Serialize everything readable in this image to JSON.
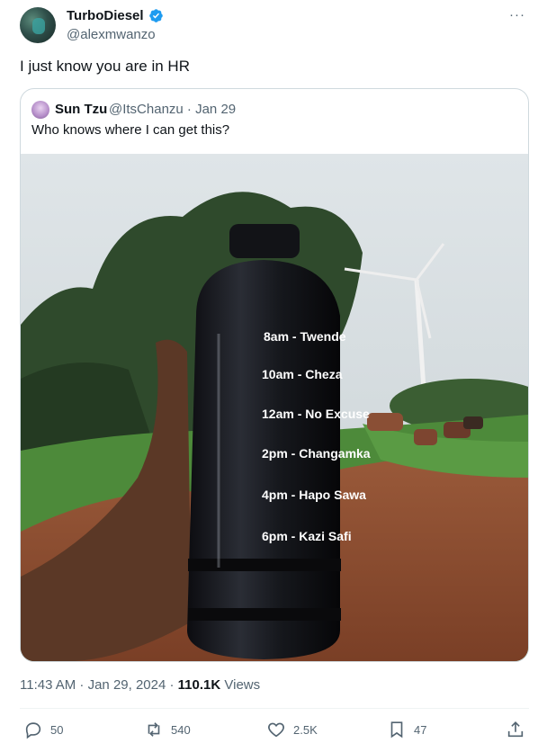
{
  "author": {
    "display_name": "TurboDiesel",
    "handle": "@alexmwanzo",
    "avatar_icon": "profile-photo-icon",
    "verified_icon": "verified-badge-icon",
    "verified_color": "#1d9bf0"
  },
  "more_label": "···",
  "tweet": {
    "text": "I just know you are in HR",
    "timestamp": "11:43 AM · Jan 29, 2024 · ",
    "views_count": "110.1K",
    "views_label": " Views"
  },
  "quoted": {
    "name": "Sun Tzu",
    "meta": "@ItsChanzu · Jan 29",
    "text": "Who knows where I can get this?",
    "bottle_schedule": [
      "8am - Twende",
      "10am - Cheza",
      "12am - No Excuse",
      "2pm - Changamka",
      "4pm - Hapo Sawa",
      "6pm - Kazi Safi"
    ]
  },
  "actions": {
    "reply": {
      "count": "50",
      "icon": "reply-icon"
    },
    "repost": {
      "count": "540",
      "icon": "repost-icon"
    },
    "like": {
      "count": "2.5K",
      "icon": "heart-icon"
    },
    "bookmark": {
      "count": "47",
      "icon": "bookmark-icon"
    },
    "share": {
      "icon": "share-icon"
    }
  },
  "colors": {
    "text_primary": "#0f1419",
    "text_secondary": "#536471",
    "border": "#cfd9de"
  }
}
